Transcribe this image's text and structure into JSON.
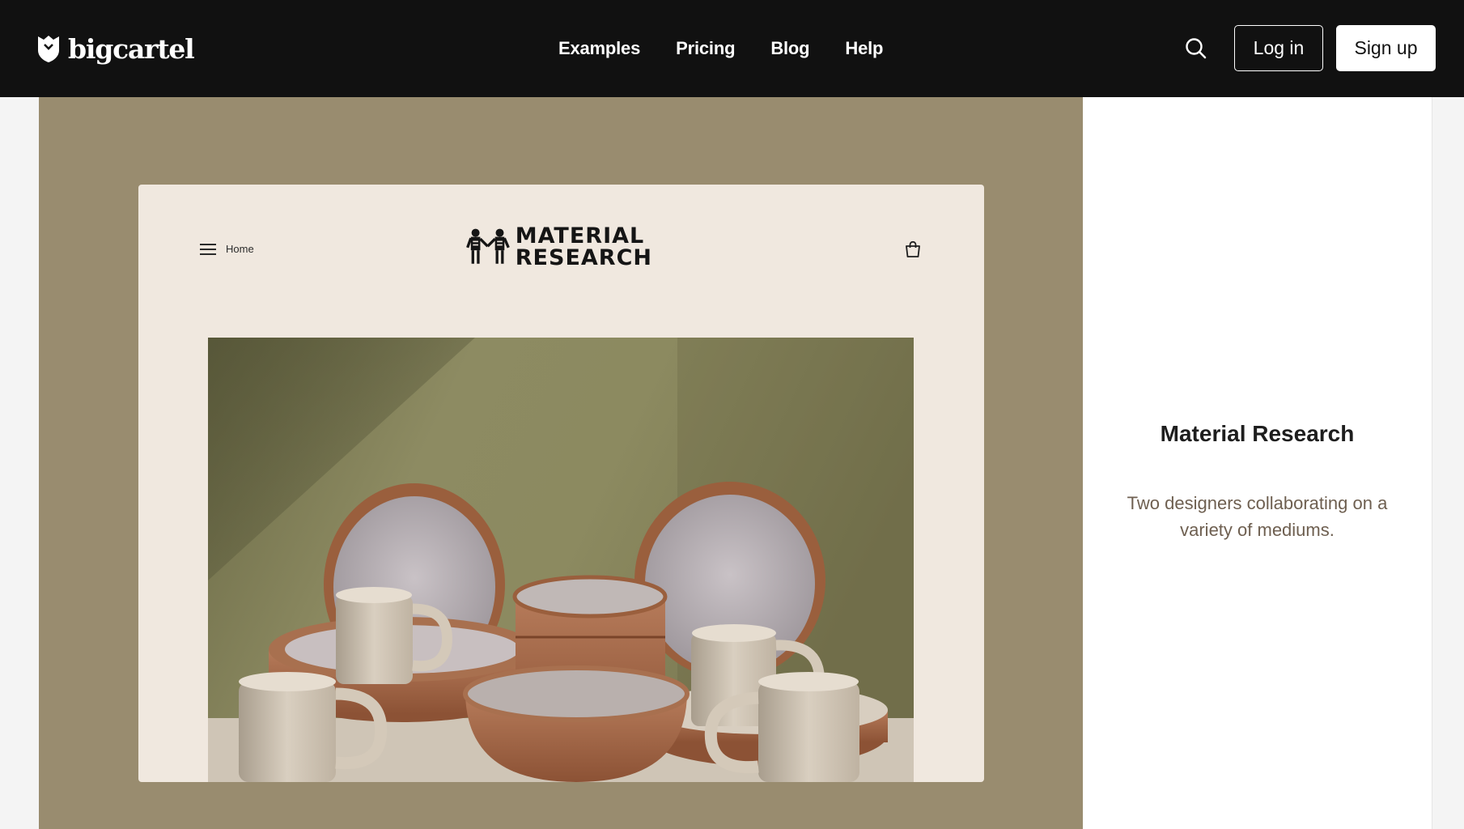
{
  "colors": {
    "topbar": "#111111",
    "showcase_bg": "#998c6f",
    "preview_bg": "#f0e8df",
    "info_bg": "#ffffff",
    "info_desc": "#6e5f50"
  },
  "brand": {
    "name": "bigcartel",
    "icon": "bigcartel-shield-icon"
  },
  "nav": {
    "links": [
      "Examples",
      "Pricing",
      "Blog",
      "Help"
    ],
    "search_icon": "search-icon",
    "login_label": "Log in",
    "signup_label": "Sign up"
  },
  "preview": {
    "menu_icon": "hamburger-icon",
    "home_label": "Home",
    "logo_line1": "MATERIAL",
    "logo_line2": "RESEARCH",
    "cart_icon": "shopping-bag-icon",
    "hero_image": "ceramic-dishware-photo"
  },
  "store": {
    "title": "Material Research",
    "description": "Two designers collaborating on a variety of mediums."
  }
}
